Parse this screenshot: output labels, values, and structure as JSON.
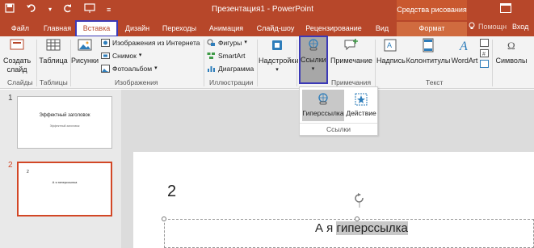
{
  "window": {
    "title": "Презентация1 - PowerPoint",
    "context_header": "Средства рисования"
  },
  "tabs": [
    {
      "label": "Файл"
    },
    {
      "label": "Главная"
    },
    {
      "label": "Вставка"
    },
    {
      "label": "Дизайн"
    },
    {
      "label": "Переходы"
    },
    {
      "label": "Анимация"
    },
    {
      "label": "Слайд-шоу"
    },
    {
      "label": "Рецензирование"
    },
    {
      "label": "Вид"
    },
    {
      "label": "Формат"
    }
  ],
  "tell_me": "Помощн",
  "sign_in": "Вход",
  "ribbon": {
    "slides": {
      "new_slide": "Создать слайд",
      "group": "Слайды"
    },
    "tables": {
      "table": "Таблица",
      "group": "Таблицы"
    },
    "images": {
      "pictures": "Рисунки",
      "online": "Изображения из Интернета",
      "screenshot": "Снимок",
      "album": "Фотоальбом",
      "group": "Изображения"
    },
    "illustrations": {
      "shapes": "Фигуры",
      "smartart": "SmartArt",
      "chart": "Диаграмма",
      "group": "Иллюстрации"
    },
    "addins": {
      "label": "Надстройки"
    },
    "links": {
      "label": "Ссылки",
      "group": "Примечания"
    },
    "comments": {
      "label": "Примечание"
    },
    "text": {
      "textbox": "Надпись",
      "header_footer": "Колонтитулы",
      "wordart": "WordArt",
      "group": "Текст"
    },
    "symbols": {
      "label": "Символы"
    }
  },
  "links_dropdown": {
    "hyperlink": "Гиперссылка",
    "action": "Действие",
    "group": "Ссылки"
  },
  "thumbnails": [
    {
      "number": "1",
      "title": "Эффектный заголовок",
      "subtitle": "Эффектный заголовок"
    },
    {
      "number": "2",
      "slide_num": "2",
      "text": "А я гиперссылка"
    }
  ],
  "slide": {
    "number": "2",
    "text_plain": "А я ",
    "text_link": "гиперссылка"
  },
  "colors": {
    "accent": "#b7472a",
    "highlight_box": "#3c3ab7",
    "selected_thumb": "#d24726"
  }
}
